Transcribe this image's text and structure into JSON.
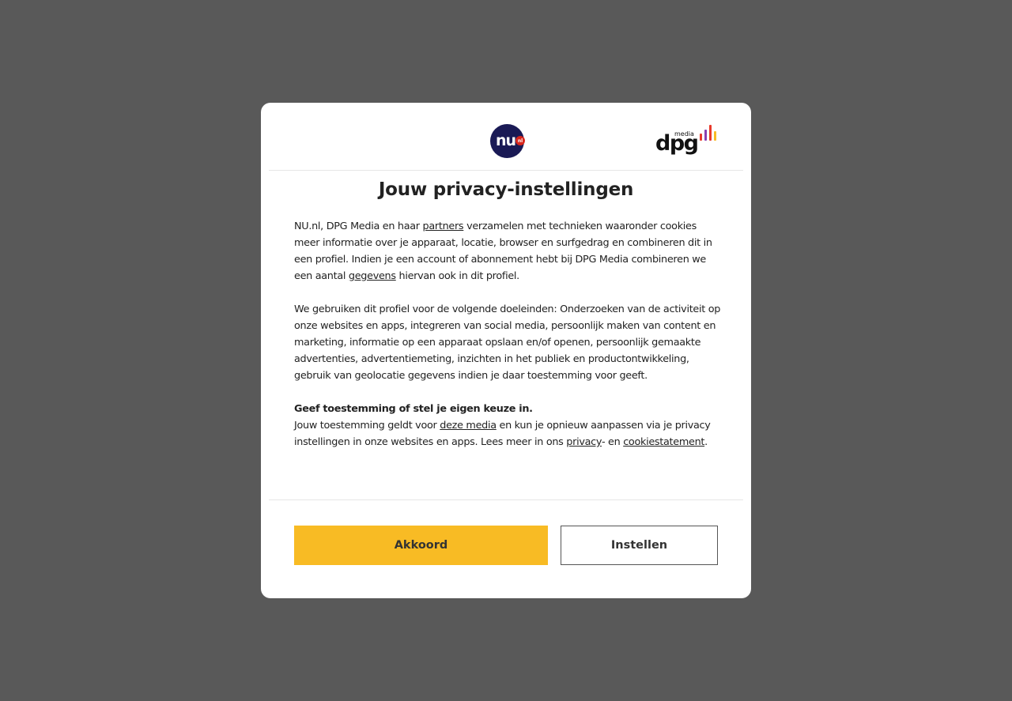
{
  "colors": {
    "overlay": "#595959",
    "accent": "#f8bb24",
    "nu_logo_bg": "#1a1a55",
    "nu_logo_dot": "#d9261c"
  },
  "logos": {
    "nu": {
      "text": "nu",
      "badge": "nl",
      "icon": "nu-nl-logo"
    },
    "dpg": {
      "small": "media",
      "main": "dpg",
      "icon": "dpg-media-logo"
    }
  },
  "modal": {
    "title": "Jouw privacy-instellingen",
    "p1": {
      "t1": "NU.nl, DPG Media en haar ",
      "link1": "partners",
      "t2": " verzamelen met technieken waaronder cookies meer informatie over je apparaat, locatie, browser en surfgedrag en combineren dit in een profiel. Indien je een account of abonnement hebt bij DPG Media combineren we een aantal ",
      "link2": "gegevens",
      "t3": " hiervan ook in dit profiel."
    },
    "p2": "We gebruiken dit profiel voor de volgende doeleinden: Onderzoeken van de activiteit op onze websites en apps, integreren van social media, persoonlijk maken van content en marketing, informatie op een apparaat opslaan en/of openen, persoonlijk gemaakte advertenties, advertentiemeting, inzichten in het publiek en productontwikkeling, gebruik van geolocatie gegevens indien je daar toestemming voor geeft.",
    "p3": {
      "heading": "Geef toestemming of stel je eigen keuze in.",
      "t1": "Jouw toestemming geldt voor ",
      "link1": "deze media",
      "t2": " en kun je opnieuw aanpassen via je privacy instellingen in onze websites en apps. Lees meer in ons ",
      "link2": "privacy",
      "t3": "- en ",
      "link3": "cookiestatement",
      "t4": "."
    },
    "buttons": {
      "accept": "Akkoord",
      "settings": "Instellen"
    }
  }
}
